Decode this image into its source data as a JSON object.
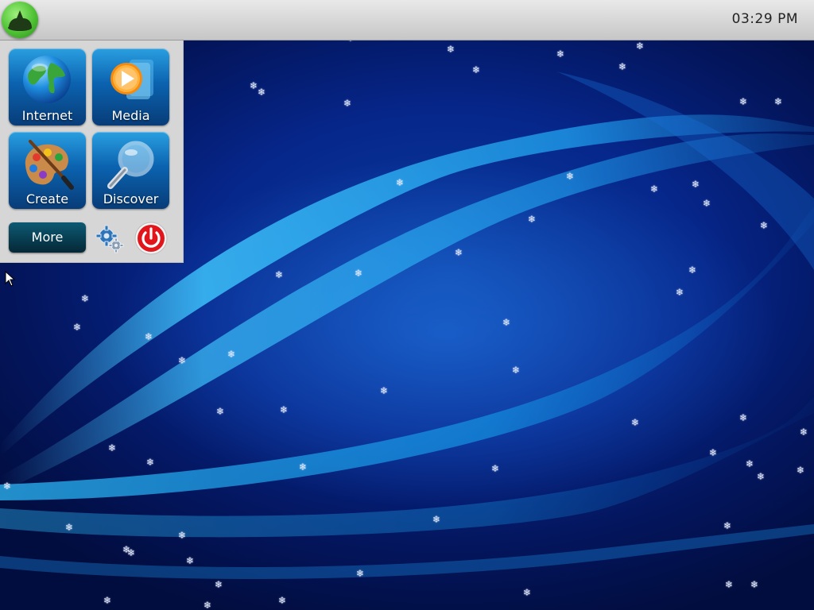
{
  "top_panel": {
    "start_icon": "kids-os-logo-icon",
    "clock": "03:29 PM"
  },
  "launcher": {
    "tiles": [
      {
        "label": "Internet",
        "icon": "globe-icon"
      },
      {
        "label": "Media",
        "icon": "media-play-icon"
      },
      {
        "label": "Create",
        "icon": "paint-palette-icon"
      },
      {
        "label": "Discover",
        "icon": "magnifier-icon"
      }
    ],
    "more_label": "More",
    "settings_icon": "gears-icon",
    "power_icon": "power-icon"
  },
  "colors": {
    "desktop_blue": "#06268a",
    "tile_blue": "#0b63b0",
    "start_green": "#4fc235",
    "power_red": "#e0161c"
  }
}
